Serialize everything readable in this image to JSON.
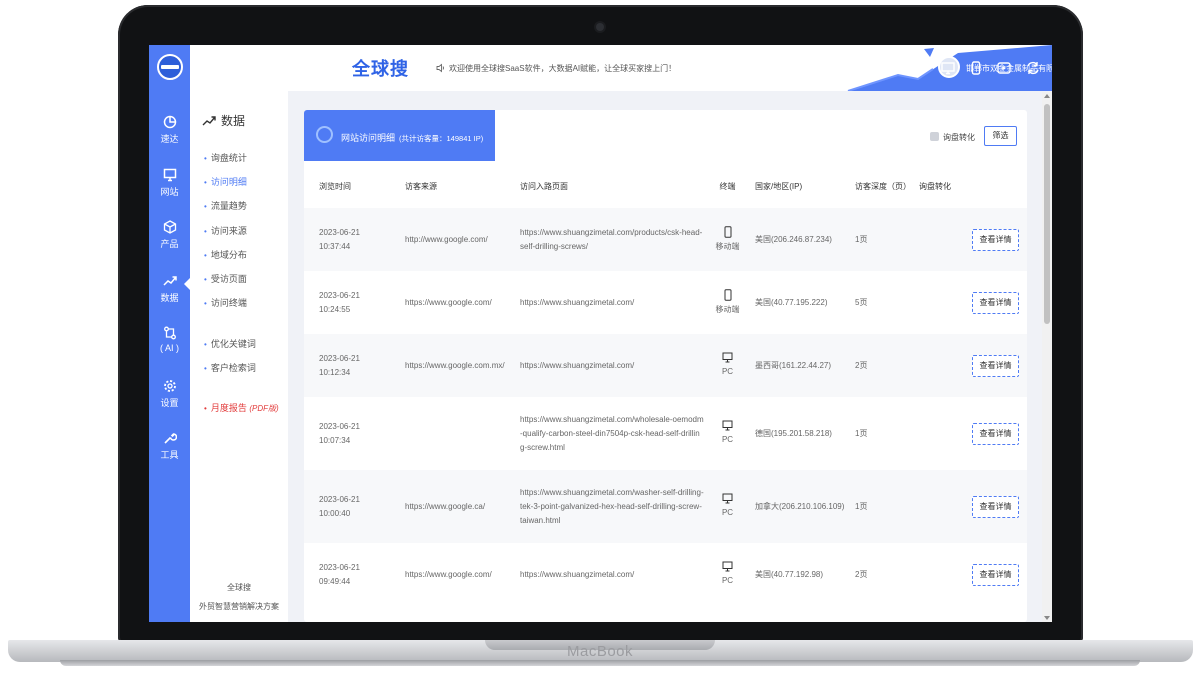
{
  "device": {
    "brand": "MacBook"
  },
  "app": {
    "logo_text": "全球搜",
    "notice": "欢迎使用全球搜SaaS软件，大数据AI赋能，让全球买家搜上门！"
  },
  "user": {
    "company": "邯郸市双金金属制品有限..."
  },
  "nav": {
    "items": [
      {
        "label": "速达",
        "icon": "pie-chart-icon"
      },
      {
        "label": "网站",
        "icon": "monitor-icon"
      },
      {
        "label": "产品",
        "icon": "cube-icon"
      },
      {
        "label": "数据",
        "icon": "trend-icon"
      },
      {
        "label": "( AI )",
        "icon": "ai-flow-icon"
      },
      {
        "label": "设置",
        "icon": "gear-icon"
      },
      {
        "label": "工具",
        "icon": "wrench-icon"
      }
    ]
  },
  "submenu": {
    "title": "数据",
    "items": [
      "询盘统计",
      "访问明细",
      "流量趋势",
      "访问来源",
      "地域分布",
      "受访页面",
      "访问终端"
    ],
    "items2": [
      "优化关键词",
      "客户检索词"
    ],
    "report": "月度报告",
    "report_suffix": "(PDF版)",
    "footer_line1": "全球搜",
    "footer_line2": "外贸智慧营销解决方案"
  },
  "card": {
    "tab_title": "网站访问明细",
    "tab_sub": "(共计访客量：149841 IP)",
    "inquiry_label": "询盘转化",
    "filter_label": "筛选"
  },
  "table": {
    "headers": [
      "浏览时间",
      "访客来源",
      "访问入路页面",
      "终端",
      "国家/地区(IP)",
      "访客深度（页）",
      "询盘转化",
      ""
    ],
    "button_label": "查看详情",
    "rows": [
      {
        "time": "2023-06-21 10:37:44",
        "source": "http://www.google.com/",
        "page": "https://www.shuangzimetal.com/products/csk-head-self-drilling-screws/",
        "terminal": "移动端",
        "country": "美国(206.246.87.234)",
        "depth": "1页",
        "inquiry": ""
      },
      {
        "time": "2023-06-21 10:24:55",
        "source": "https://www.google.com/",
        "page": "https://www.shuangzimetal.com/",
        "terminal": "移动端",
        "country": "美国(40.77.195.222)",
        "depth": "5页",
        "inquiry": ""
      },
      {
        "time": "2023-06-21 10:12:34",
        "source": "https://www.google.com.mx/",
        "page": "https://www.shuangzimetal.com/",
        "terminal": "PC",
        "country": "墨西哥(161.22.44.27)",
        "depth": "2页",
        "inquiry": ""
      },
      {
        "time": "2023-06-21 10:07:34",
        "source": "",
        "page": "https://www.shuangzimetal.com/wholesale-oemodm-qualify-carbon-steel-din7504p-csk-head-self-drilling-screw.html",
        "terminal": "PC",
        "country": "德国(195.201.58.218)",
        "depth": "1页",
        "inquiry": ""
      },
      {
        "time": "2023-06-21 10:00:40",
        "source": "https://www.google.ca/",
        "page": "https://www.shuangzimetal.com/washer-self-drilling-tek-3-point-galvanized-hex-head-self-drilling-screw-taiwan.html",
        "terminal": "PC",
        "country": "加拿大(206.210.106.109)",
        "depth": "1页",
        "inquiry": ""
      },
      {
        "time": "2023-06-21 09:49:44",
        "source": "https://www.google.com/",
        "page": "https://www.shuangzimetal.com/",
        "terminal": "PC",
        "country": "美国(40.77.192.98)",
        "depth": "2页",
        "inquiry": ""
      }
    ]
  },
  "colors": {
    "accent": "#4f7bf4",
    "report": "#e23b3b"
  }
}
